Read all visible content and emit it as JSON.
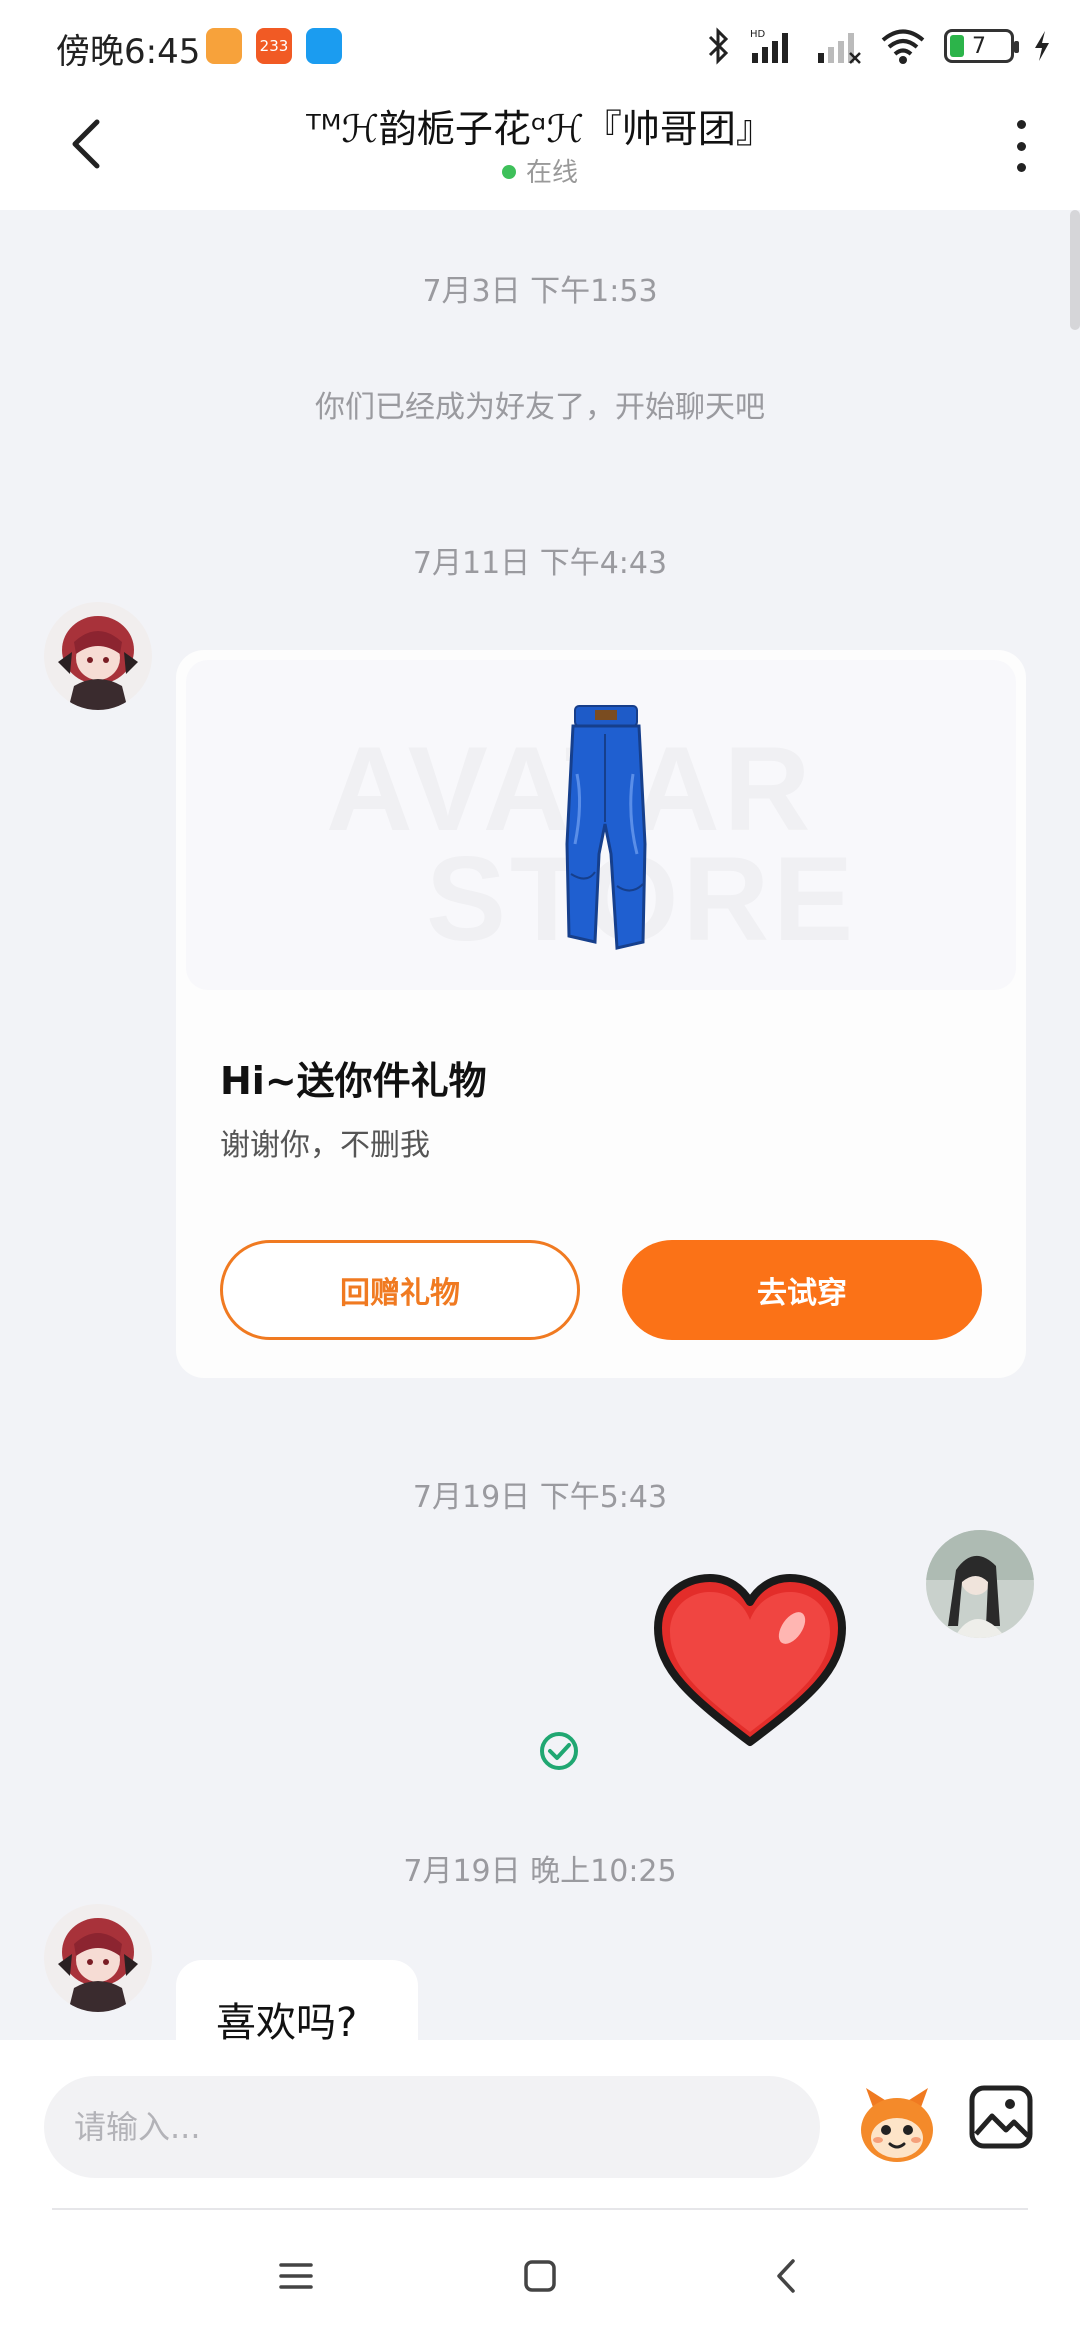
{
  "status_bar": {
    "time": "傍晚6:45",
    "battery_level": "7",
    "icons": [
      "video-app-icon",
      "233-app-icon",
      "blue-app-icon",
      "bluetooth-icon",
      "signal-hd-icon",
      "signal-weak-icon",
      "wifi-icon",
      "battery-icon",
      "charging-icon"
    ]
  },
  "header": {
    "title": "ᵀᴹℋ韵栀子花ᵅℋ『帅哥团』",
    "status": "在线"
  },
  "chat": {
    "messages": [
      {
        "type": "timestamp",
        "text": "7月3日 下午1:53"
      },
      {
        "type": "system",
        "text": "你们已经成为好友了，开始聊天吧"
      },
      {
        "type": "timestamp",
        "text": "7月11日 下午4:43"
      },
      {
        "type": "timestamp",
        "text": "7月19日 下午5:43"
      },
      {
        "type": "timestamp",
        "text": "7月19日 晚上10:25"
      }
    ],
    "gift_card": {
      "watermark_line1": "AVATAR",
      "watermark_line2": "STORE",
      "title": "Hi~送你件礼物",
      "subtitle": "谢谢你，不删我",
      "return_gift_label": "回赠礼物",
      "try_on_label": "去试穿",
      "accent_color": "#fb7217"
    },
    "heart_sticker": "heart-icon",
    "text_message": "喜欢吗?"
  },
  "input_bar": {
    "placeholder": "请输入..."
  },
  "colors": {
    "background": "#f2f3f7",
    "accent": "#fb7217",
    "online": "#3ec05a",
    "read_check": "#20a772"
  }
}
